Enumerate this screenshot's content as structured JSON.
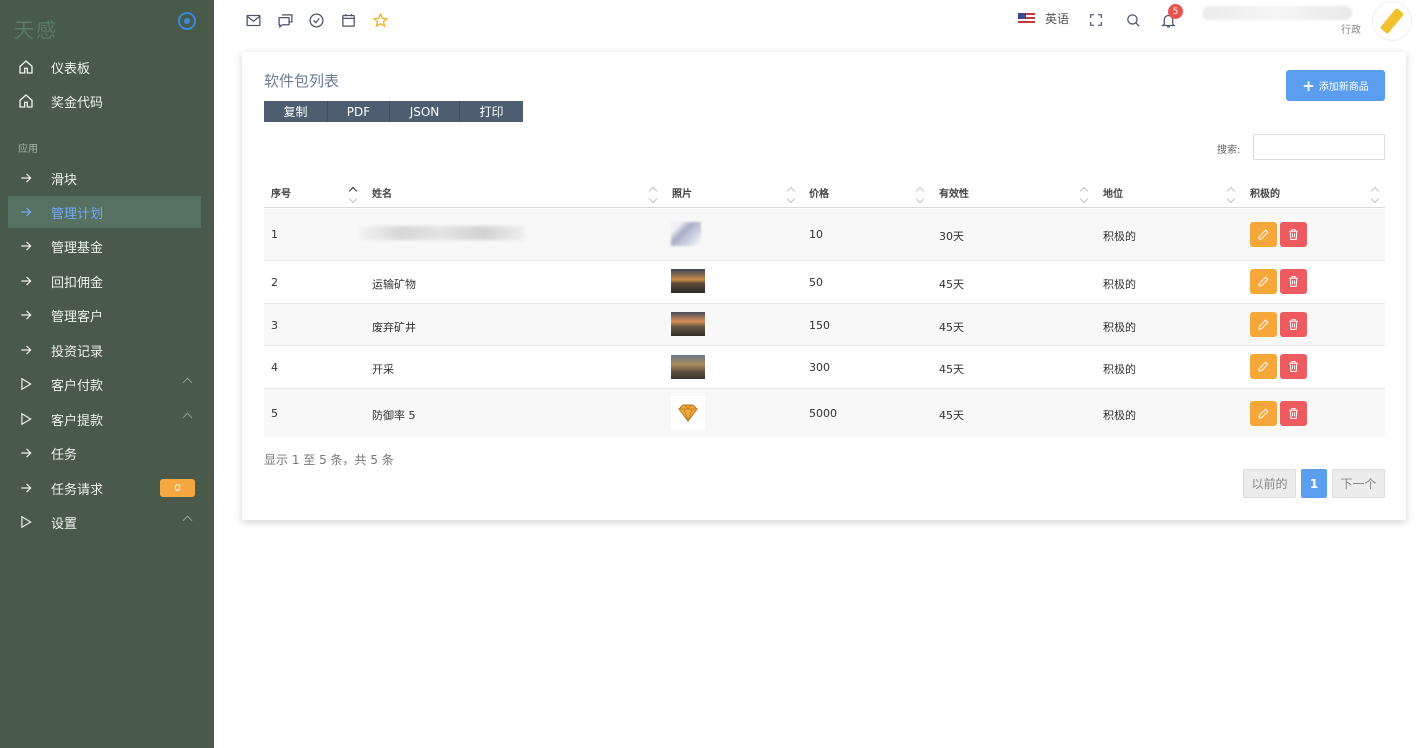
{
  "sidebar": {
    "brand": "天感",
    "section_label": "应用",
    "items": [
      {
        "label": "仪表板",
        "icon": "home-icon"
      },
      {
        "label": "奖金代码",
        "icon": "home-icon"
      },
      {
        "label": "滑块",
        "icon": "arrow-right-icon"
      },
      {
        "label": "管理计划",
        "icon": "arrow-right-icon",
        "active": true
      },
      {
        "label": "管理基金",
        "icon": "arrow-right-icon"
      },
      {
        "label": "回扣佣金",
        "icon": "arrow-right-icon"
      },
      {
        "label": "管理客户",
        "icon": "arrow-right-icon"
      },
      {
        "label": "投资记录",
        "icon": "arrow-right-icon"
      },
      {
        "label": "客户付款",
        "icon": "play-icon"
      },
      {
        "label": "客户提款",
        "icon": "play-icon"
      },
      {
        "label": "任务",
        "icon": "arrow-right-icon"
      },
      {
        "label": "任务请求",
        "icon": "arrow-right-icon",
        "badge": "0"
      },
      {
        "label": "设置",
        "icon": "play-icon"
      }
    ]
  },
  "topbar": {
    "language": "英语",
    "notification_count": "5",
    "user_role": "行政"
  },
  "card": {
    "title": "软件包列表",
    "export_buttons": [
      "复制",
      "PDF",
      "JSON",
      "打印"
    ],
    "add_button": "添加新商品",
    "search_label": "搜索:",
    "search_value": "",
    "columns": [
      "序号",
      "姓名",
      "照片",
      "价格",
      "有效性",
      "地位",
      "积极的"
    ],
    "rows": [
      {
        "id": "1",
        "name": "",
        "price": "10",
        "validity": "30天",
        "status": "积极的"
      },
      {
        "id": "2",
        "name": "运输矿物",
        "price": "50",
        "validity": "45天",
        "status": "积极的"
      },
      {
        "id": "3",
        "name": "废弃矿井",
        "price": "150",
        "validity": "45天",
        "status": "积极的"
      },
      {
        "id": "4",
        "name": "开采",
        "price": "300",
        "validity": "45天",
        "status": "积极的"
      },
      {
        "id": "5",
        "name": "防御率 5",
        "price": "5000",
        "validity": "45天",
        "status": "积极的"
      }
    ],
    "info_text": "显示 1 至 5 条，共 5 条",
    "pagination": {
      "prev": "以前的",
      "current": "1",
      "next": "下一个"
    }
  },
  "colors": {
    "sidebar_bg": "#49594a",
    "accent": "#5b9ef0",
    "edit": "#f5a73a",
    "delete": "#ed5a5f",
    "badge": "#f5a841"
  }
}
